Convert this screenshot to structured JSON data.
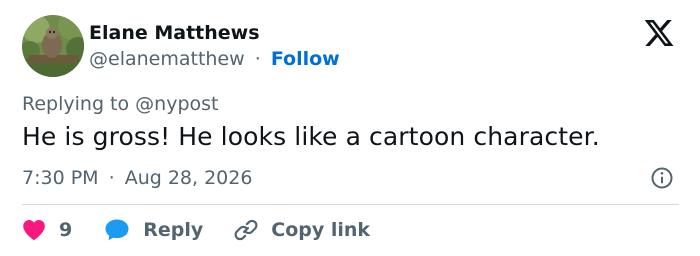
{
  "author": {
    "name": "Elane Matthews",
    "handle": "@elanematthew",
    "separator": "·",
    "follow_label": "Follow"
  },
  "reply_context": {
    "prefix": "Replying to",
    "mention": "@nypost"
  },
  "tweet": {
    "text": "He is gross! He looks like a cartoon character.",
    "time": "7:30 PM",
    "separator": "·",
    "date": "Aug 28, 2026"
  },
  "actions": {
    "like_count": "9",
    "reply_label": "Reply",
    "copy_label": "Copy link"
  },
  "icons": {
    "brand": "x-logo-icon",
    "info": "info-icon",
    "like": "heart-icon",
    "reply": "speech-bubble-icon",
    "copy": "link-icon"
  },
  "colors": {
    "like": "#f91880",
    "reply": "#1d9bf0",
    "follow": "#006fd6",
    "secondary_text": "#536471",
    "primary_text": "#0f1419"
  }
}
